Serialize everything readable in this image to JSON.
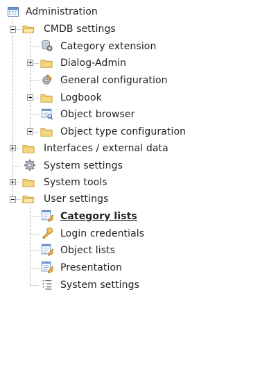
{
  "tree": {
    "root": {
      "label": "Administration",
      "icon": "calendar-admin-icon"
    },
    "nodes": [
      {
        "label": "CMDB settings",
        "icon": "folder-open-icon",
        "toggle": "collapse"
      },
      {
        "label": "Category extension",
        "icon": "database-gear-icon"
      },
      {
        "label": "Dialog-Admin",
        "icon": "folder-icon",
        "toggle": "expand"
      },
      {
        "label": "General configuration",
        "icon": "gear-pencil-icon"
      },
      {
        "label": "Logbook",
        "icon": "folder-icon",
        "toggle": "expand"
      },
      {
        "label": "Object browser",
        "icon": "object-browser-icon"
      },
      {
        "label": "Object type configuration",
        "icon": "folder-icon",
        "toggle": "expand"
      },
      {
        "label": "Interfaces / external data",
        "icon": "folder-icon",
        "toggle": "expand"
      },
      {
        "label": "System settings",
        "icon": "gear-icon"
      },
      {
        "label": "System tools",
        "icon": "folder-icon",
        "toggle": "expand"
      },
      {
        "label": "User settings",
        "icon": "folder-open-icon",
        "toggle": "collapse"
      },
      {
        "label": "Category lists",
        "icon": "list-edit-icon",
        "selected": true
      },
      {
        "label": "Login credentials",
        "icon": "key-icon"
      },
      {
        "label": "Object lists",
        "icon": "list-edit-icon"
      },
      {
        "label": "Presentation",
        "icon": "list-edit-icon"
      },
      {
        "label": "System settings",
        "icon": "list-lines-icon"
      }
    ]
  }
}
